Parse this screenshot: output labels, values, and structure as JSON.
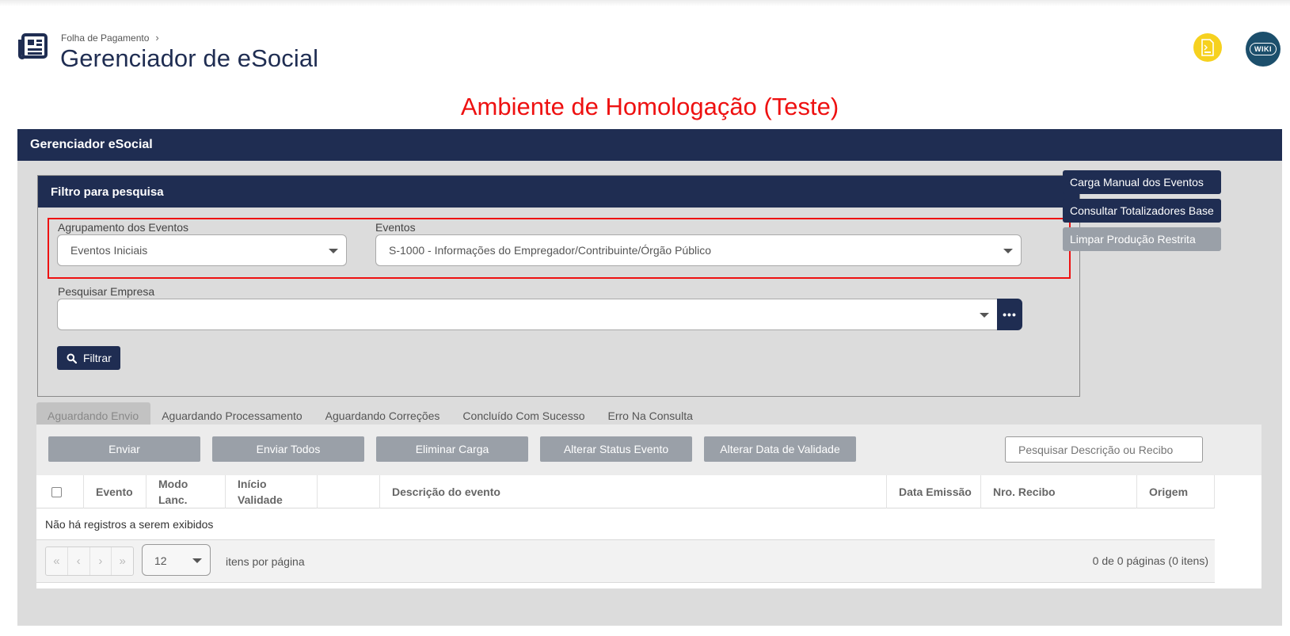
{
  "header": {
    "breadcrumb": "Folha de Pagamento",
    "breadcrumb_sep": "›",
    "title": "Gerenciador de eSocial",
    "env_banner": "Ambiente de Homologação (Teste)",
    "wiki_label": "WIKI"
  },
  "panel": {
    "title": "Gerenciador eSocial"
  },
  "filter": {
    "title": "Filtro para pesquisa",
    "grouping_label": "Agrupamento dos Eventos",
    "grouping_value": "Eventos Iniciais",
    "events_label": "Eventos",
    "events_value": "S-1000 - Informações do Empregador/Contribuinte/Órgão Público",
    "company_label": "Pesquisar Empresa",
    "company_value": "",
    "more_label": "•••",
    "filter_button": "Filtrar"
  },
  "side_actions": {
    "manual_load": "Carga Manual dos Eventos",
    "totals": "Consultar Totalizadores Base",
    "clear": "Limpar Produção Restrita"
  },
  "tabs": [
    "Aguardando Envio",
    "Aguardando Processamento",
    "Aguardando Correções",
    "Concluído Com Sucesso",
    "Erro Na Consulta"
  ],
  "toolbar": {
    "send": "Enviar",
    "send_all": "Enviar Todos",
    "delete_load": "Eliminar Carga",
    "change_status": "Alterar Status Evento",
    "change_validity": "Alterar Data de Validade",
    "search_placeholder": "Pesquisar Descrição ou Recibo"
  },
  "table": {
    "columns": {
      "evento": "Evento",
      "modo_1": "Modo",
      "modo_2": "Lanc.",
      "inicio_1": "Início",
      "inicio_2": "Validade",
      "descricao": "Descrição do evento",
      "data": "Data Emissão",
      "recibo": "Nro. Recibo",
      "origem": "Origem"
    },
    "empty": "Não há registros a serem exibidos"
  },
  "pager": {
    "first": "«",
    "prev": "‹",
    "next": "›",
    "last": "»",
    "page_size": "12",
    "per_page": "itens por página",
    "info": "0 de 0 páginas (0 itens)"
  },
  "colors": {
    "navy": "#1f2d52",
    "banner_red": "#ee1111",
    "yellow": "#f6d11f",
    "button_gray": "#9aa0a8"
  }
}
